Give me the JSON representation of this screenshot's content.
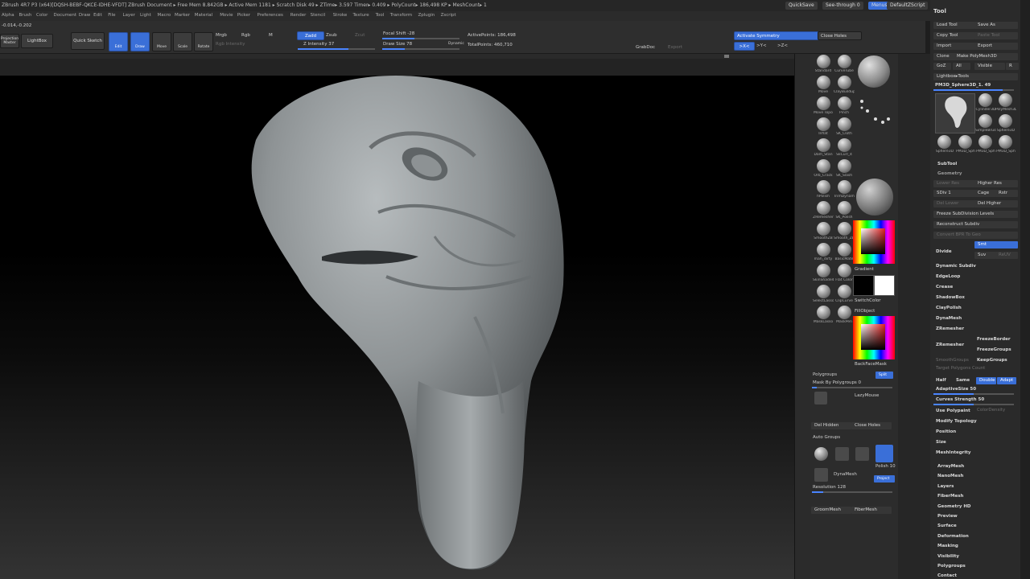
{
  "titlebar": {
    "left": "ZBrush 4R7 P3 (x64)[DQSH-BEBF-QKCE-IDHE-VFDT]    ZBrush Document       ▸ Free Mem 8.842GB ▸ Active Mem 1181 ▸ Scratch Disk 49 ▸ ZTime▸ 3.597 Timer▸ 0.409 ▸ PolyCount▸ 186,498 KP ▸ MeshCount▸ 1",
    "quicksave": "QuickSave",
    "seethrough": "See-through  0",
    "menus_btn": "Menus",
    "defaultzscript": "DefaultZScript"
  },
  "menubar": {
    "items": [
      "Alpha",
      "Brush",
      "Color",
      "Document",
      "Draw",
      "Edit",
      "File",
      "Layer",
      "Light",
      "Macro",
      "Marker",
      "Material",
      "Movie",
      "Picker",
      "Preferences",
      "Render",
      "Stencil",
      "Stroke",
      "Texture",
      "Tool",
      "Transform",
      "Zplugin",
      "Zscript"
    ]
  },
  "toolbar": {
    "coords": "-0.014,-0.202",
    "projection_master": "Projection Master",
    "lightbox": "LightBox",
    "quick_sketch": "Quick Sketch",
    "edit": "Edit",
    "draw": "Draw",
    "move": "Move",
    "scale": "Scale",
    "rotate": "Rotate",
    "mrgb": "Mrgb",
    "rgb": "Rgb",
    "m": "M",
    "zadd": "Zadd",
    "zsub": "Zsub",
    "zcut": "Zcut",
    "rgb_intensity": "Rgb Intensity",
    "z_intensity": "Z Intensity 37",
    "focal_shift": "Focal Shift -28",
    "draw_size": "Draw Size 78",
    "dynamic": "Dynamic",
    "active_points": "ActivePoints: 186,498",
    "total_points": "TotalPoints: 460,710",
    "grabdoc": "GrabDoc",
    "export": "Export",
    "activate_symmetry": "Activate Symmetry",
    "close_holes": "Close Holes",
    "x": ">X<",
    "y": ">Y<",
    "z": ">Z<"
  },
  "shelf": {
    "brushes": [
      {
        "label": "Standard"
      },
      {
        "label": "CurveTube"
      },
      {
        "label": "Move"
      },
      {
        "label": "ClayBuildup"
      },
      {
        "label": "Move Topo"
      },
      {
        "label": "Pinch"
      },
      {
        "label": "Inflat"
      },
      {
        "label": "SK_Cloth"
      },
      {
        "label": "Dam_Stan"
      },
      {
        "label": "SkCurl_4"
      },
      {
        "label": "Orb_Crack"
      },
      {
        "label": "SK_Slash"
      },
      {
        "label": "hPolish"
      },
      {
        "label": "TrimDynam"
      },
      {
        "label": "ZRemesher"
      },
      {
        "label": "SK_Polish"
      },
      {
        "label": "SmoothZB"
      },
      {
        "label": "Smooth_ZB"
      },
      {
        "label": "mah_dirty"
      },
      {
        "label": "BasicMate"
      },
      {
        "label": "SkinShade4"
      },
      {
        "label": "Flat Color"
      },
      {
        "label": "SelectLasso"
      },
      {
        "label": "ClipCurve"
      },
      {
        "label": "MaskLasso"
      },
      {
        "label": "MaskPen"
      }
    ],
    "gradient": "Gradient",
    "switchcolor": "SwitchColor",
    "fillobject": "FillObject",
    "backface_mask": "BackFaceMask",
    "polygroups": "Polygroups",
    "split": "Split",
    "mask_by_polygroups": "Mask By Polygroups 0",
    "group": "Group",
    "lazymouse": "LazyMouse",
    "del_hidden": "Del Hidden",
    "close_holes": "Close Holes",
    "auto_groups": "Auto Groups",
    "dynamesh": "DynaMesh",
    "polish": "Polish 10",
    "project": "Project",
    "resolution": "Resolution 128",
    "groom": "GroomMesh",
    "fibermesh": "FiberMesh"
  },
  "tool": {
    "title": "Tool",
    "load_tool": "Load Tool",
    "save_as": "Save As",
    "copy_tool": "Copy Tool",
    "paste_tool": "Paste Tool",
    "import": "Import",
    "export": "Export",
    "clone": "Clone",
    "make_polymesh": "Make PolyMesh3D",
    "goz": "GoZ",
    "all": "All",
    "visible": "Visible",
    "r": "R",
    "lightbox_tools": "Lightbox▸Tools",
    "current_tool": "PM3D_Sphere3D_1. 49",
    "thumbs": [
      "Sphere3D",
      "Cylinder3D",
      "PolyMesh3D",
      "SimpleBrush",
      "Sphere3D",
      "Sphere3D",
      "PM3D_Sph",
      "PM3D_Sph",
      "PM3D_Sph"
    ],
    "subtool": "SubTool",
    "geometry": "Geometry",
    "lower_res": "Lower Res",
    "higher_res": "Higher Res",
    "sdiv": "SDiv 1",
    "cage": "Cage",
    "rstr": "Rstr",
    "del_lower": "Del Lower",
    "del_higher": "Del Higher",
    "freeze_subdivision": "Freeze SubDivision Levels",
    "reconstruct_subdiv": "Reconstruct Subdiv",
    "convert_bpr": "Convert BPR To Geo",
    "divide": "Divide",
    "smt": "Smt",
    "suv": "Suv",
    "reuv": "ReUV",
    "dynamic_subdiv": "Dynamic Subdiv",
    "edgeloop": "EdgeLoop",
    "crease": "Crease",
    "shadowbox": "ShadowBox",
    "claypolish": "ClayPolish",
    "dynamesh": "DynaMesh",
    "zremesher_header": "ZRemesher",
    "zremesher": "ZRemesher",
    "freeze_border": "FreezeBorder",
    "freeze_groups": "FreezeGroups",
    "smooth_groups": "SmoothGroups",
    "keep_groups": "KeepGroups",
    "target_polygons": "Target Polygons Count",
    "half": "Half",
    "same": "Same",
    "double": "Double",
    "adapt": "Adapt",
    "adaptive_size": "AdaptiveSize 50",
    "curves_strength": "Curves Strength 50",
    "use_polypaint": "Use Polypaint",
    "color_density": "ColorDensity",
    "modify_topology": "Modify Topology",
    "position": "Position",
    "size": "Size",
    "mesh_integrity": "MeshIntegrity",
    "sections": [
      "ArrayMesh",
      "NanoMesh",
      "Layers",
      "FiberMesh",
      "Geometry HD",
      "Preview",
      "Surface",
      "Deformation",
      "Masking",
      "Visibility",
      "Polygroups",
      "Contact"
    ]
  },
  "colors": {
    "accent_blue": "#3a6fd8",
    "model_gray": "#8e9395"
  }
}
